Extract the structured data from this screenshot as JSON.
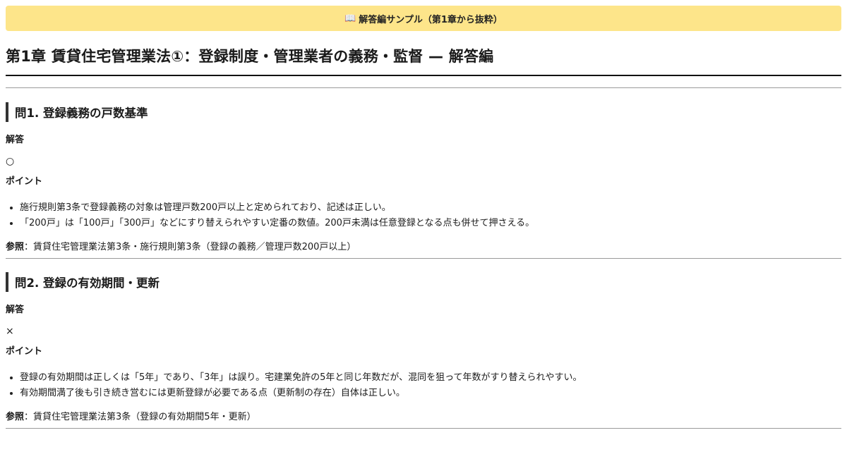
{
  "banner": {
    "icon": "open-book-icon",
    "text": "解答編サンプル（第1章から抜粋）"
  },
  "page": {
    "title": "第1章 賃貸住宅管理業法①：登録制度・管理業者の義務・監督 — 解答編"
  },
  "questions": [
    {
      "heading": "問1. 登録義務の戸数基準",
      "answer_label": "解答",
      "answer": "○",
      "points_label": "ポイント",
      "points": [
        "施行規則第3条で登録義務の対象は管理戸数200戸以上と定められており、記述は正しい。",
        "「200戸」は「100戸」「300戸」などにすり替えられやすい定番の数値。200戸未満は任意登録となる点も併せて押さえる。"
      ],
      "ref_label": "参照",
      "ref_sep": "：",
      "ref_text": "賃貸住宅管理業法第3条・施行規則第3条（登録の義務／管理戸数200戸以上）"
    },
    {
      "heading": "問2. 登録の有効期間・更新",
      "answer_label": "解答",
      "answer": "×",
      "points_label": "ポイント",
      "points": [
        "登録の有効期間は正しくは「5年」であり、「3年」は誤り。宅建業免許の5年と同じ年数だが、混同を狙って年数がすり替えられやすい。",
        "有効期間満了後も引き続き営むには更新登録が必要である点（更新制の存在）自体は正しい。"
      ],
      "ref_label": "参照",
      "ref_sep": "：",
      "ref_text": "賃貸住宅管理業法第3条（登録の有効期間5年・更新）"
    }
  ]
}
